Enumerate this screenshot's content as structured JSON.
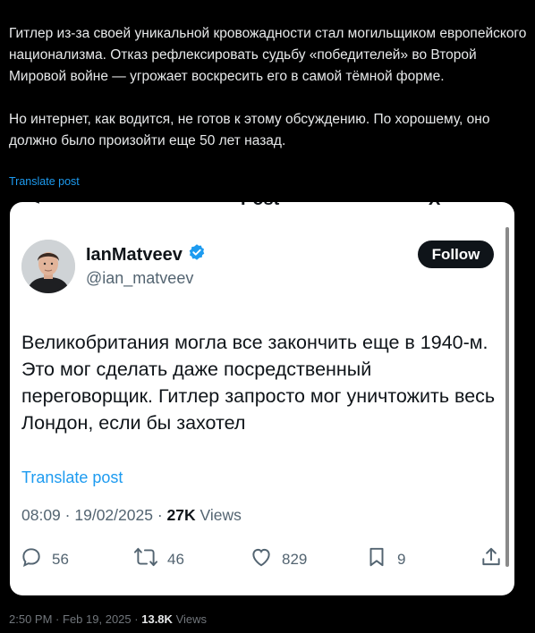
{
  "post": {
    "paragraph_1": "Гитлер из-за своей уникальной кровожадности стал могильщиком европейского национализма. Отказ рефлексировать судьбу «победителей» во Второй Мировой войне — угрожает воскресить его в самой тёмной форме.",
    "paragraph_2": "Но интернет, как водится, не готов к этому обсуждению. По хорошему, оно должно было произойти еще 50 лет назад.",
    "translate_label": "Translate post",
    "footer": {
      "time": "2:50 PM",
      "sep": "·",
      "date": "Feb 19, 2025",
      "views_count": "13.8K",
      "views_label": "Views"
    }
  },
  "embedded": {
    "header_clip": {
      "left": "<",
      "mid": "Post",
      "right": "X"
    },
    "author": {
      "name": "IanMatveev",
      "handle": "@ian_matveev",
      "verified_icon": "verified-badge-icon"
    },
    "follow_label": "Follow",
    "text": "Великобритания могла все закончить еще в 1940-м. Это мог сделать даже посредственный переговорщик. Гитлер запросто мог уничтожить весь Лондон, если бы захотел",
    "translate_label": "Translate post",
    "meta": {
      "time": "08:09",
      "date": "19/02/2025",
      "sep": "·",
      "views_count": "27K",
      "views_label": "Views"
    },
    "actions": {
      "replies": "56",
      "reposts": "46",
      "likes": "829",
      "bookmarks": "9"
    },
    "colors": {
      "accent": "#1d9bf0",
      "text": "#0f1419",
      "muted": "#536471"
    }
  }
}
